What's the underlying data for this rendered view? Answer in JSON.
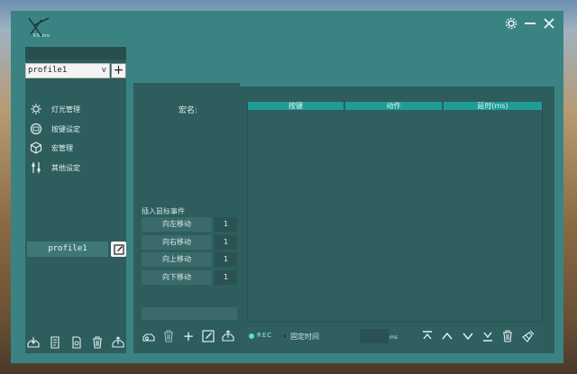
{
  "app": {
    "logo_text": "KS.mo"
  },
  "profile": {
    "selected": "profile1",
    "caret": "v",
    "add_symbol": "+",
    "current_name": "profile1"
  },
  "nav": {
    "items": [
      {
        "label": "灯光管理",
        "icon": "lightbulb-icon"
      },
      {
        "label": "按键设定",
        "icon": "keyboard-icon"
      },
      {
        "label": "宏管理",
        "icon": "cube-icon"
      },
      {
        "label": "其他设定",
        "icon": "sliders-icon"
      }
    ]
  },
  "macro": {
    "name_label": "宏名:",
    "insert_label": "插入鼠标事件",
    "mouse_events": [
      {
        "label": "向左移动",
        "value": "1"
      },
      {
        "label": "向右移动",
        "value": "1"
      },
      {
        "label": "向上移动",
        "value": "1"
      },
      {
        "label": "向下移动",
        "value": "1"
      }
    ],
    "add_symbol": "+"
  },
  "table": {
    "headers": [
      "按键",
      "动作",
      "延时(ms)"
    ]
  },
  "controls": {
    "rec_label": "REC",
    "fixed_time_label": "固定时间",
    "ms_unit": "ms"
  },
  "colors": {
    "window": "#3b8383",
    "panel": "#2d5d5d",
    "header": "#1f9c95"
  }
}
